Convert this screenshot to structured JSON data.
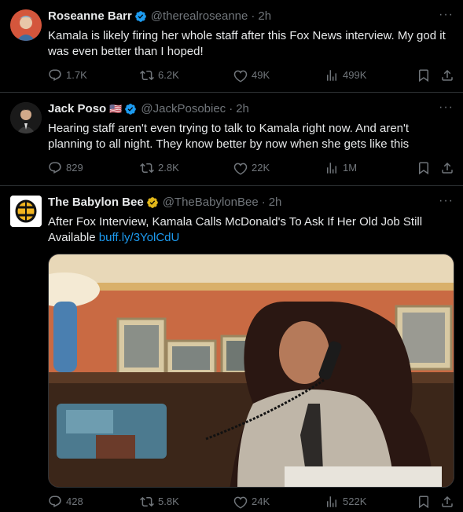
{
  "tweets": [
    {
      "name": "Roseanne Barr",
      "handle": "@therealroseanne",
      "time": "2h",
      "text": "Kamala is likely firing her whole staff after this Fox News interview. My god it was even better than I hoped!",
      "replies": "1.7K",
      "retweets": "6.2K",
      "likes": "49K",
      "views": "499K",
      "verified": "blue"
    },
    {
      "name": "Jack Poso",
      "flag": "🇺🇸",
      "handle": "@JackPosobiec",
      "time": "2h",
      "text": "Hearing staff aren't even trying to talk to Kamala right now. And aren't planning to all night. They know better by now when she gets like this",
      "replies": "829",
      "retweets": "2.8K",
      "likes": "22K",
      "views": "1M",
      "verified": "blue"
    },
    {
      "name": "The Babylon Bee",
      "handle": "@TheBabylonBee",
      "time": "2h",
      "text": "After Fox Interview, Kamala Calls McDonald's To Ask If Her Old Job Still Available ",
      "link": "buff.ly/3YolCdU",
      "replies": "428",
      "retweets": "5.8K",
      "likes": "24K",
      "views": "522K",
      "verified": "gold"
    }
  ],
  "dot": "·",
  "more": "···",
  "colors": {
    "background": "#000000",
    "text": "#e7e9ea",
    "muted": "#71767b",
    "link": "#1d9bf0",
    "verified_blue": "#1d9bf0",
    "verified_gold": "#e2b719"
  },
  "icons": [
    "reply-icon",
    "retweet-icon",
    "like-icon",
    "views-icon",
    "bookmark-icon",
    "share-icon",
    "verified-badge-icon",
    "more-icon"
  ]
}
